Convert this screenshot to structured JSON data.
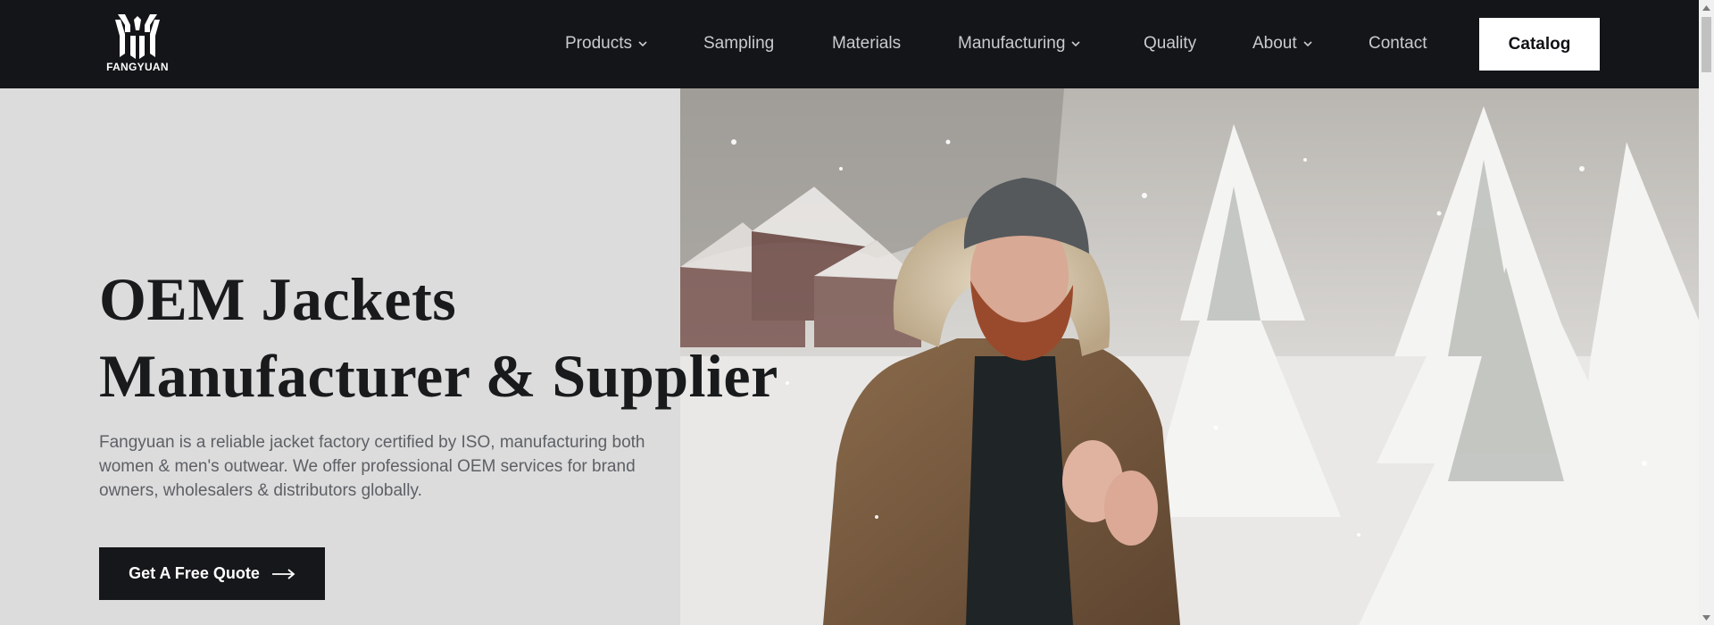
{
  "brand": {
    "name": "FANGYUAN",
    "logo_icon": "fangyuan-logo-icon"
  },
  "nav": {
    "items": [
      {
        "label": "Products",
        "has_dropdown": true
      },
      {
        "label": "Sampling",
        "has_dropdown": false
      },
      {
        "label": "Materials",
        "has_dropdown": false
      },
      {
        "label": "Manufacturing",
        "has_dropdown": true
      },
      {
        "label": "Quality",
        "has_dropdown": false
      },
      {
        "label": "About",
        "has_dropdown": true
      },
      {
        "label": "Contact",
        "has_dropdown": false
      }
    ],
    "catalog_label": "Catalog"
  },
  "hero": {
    "title_line1": "OEM Jackets",
    "title_line2": "Manufacturer & Supplier",
    "description": "Fangyuan is a reliable jacket factory certified by ISO, manufacturing both women & men's outwear. We offer professional OEM services for brand owners, wholesalers & distributors globally.",
    "cta_label": "Get A Free Quote",
    "cta_icon": "arrow-right-icon",
    "image_subject": "man-in-brown-winter-jacket-snow-photo"
  },
  "colors": {
    "header_bg": "#131518",
    "hero_left_bg": "#dcdcdc",
    "nav_text": "#c9cbce",
    "cta_bg": "#15171a",
    "catalog_bg": "#ffffff"
  }
}
